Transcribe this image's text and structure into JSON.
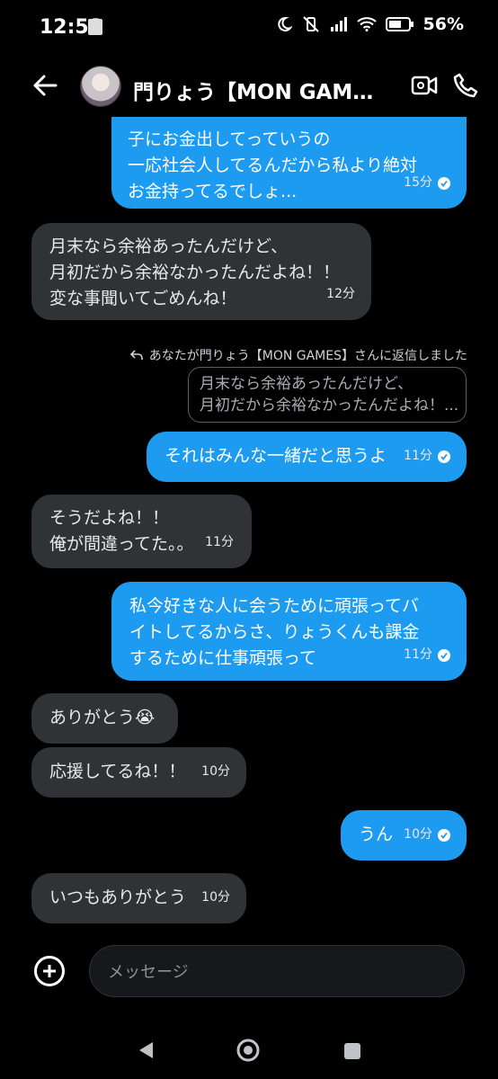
{
  "status_bar": {
    "time": "12:58",
    "battery": "56%"
  },
  "header": {
    "title": "門りょう【MON GAMES..."
  },
  "messages": [
    {
      "direction": "out",
      "lines": [
        "子にお金出してっていうの",
        "一応社会人してるんだから私より絶対",
        "お金持ってるでしょ..."
      ],
      "time": "15分",
      "read": true
    },
    {
      "direction": "in",
      "lines": [
        "月末なら余裕あったんだけど、",
        "月初だから余裕なかったんだよね！！",
        "変な事聞いてごめんね！"
      ],
      "time": "12分"
    },
    {
      "direction": "out",
      "lines": [
        "それはみんな一緒だと思うよ"
      ],
      "time": "11分",
      "read": true
    },
    {
      "direction": "in",
      "lines": [
        "そうだよね！！",
        "俺が間違ってた。。"
      ],
      "time": "11分"
    },
    {
      "direction": "out",
      "lines": [
        "私今好きな人に会うために頑張ってバ",
        "イトしてるからさ、りょうくんも課金",
        "するために仕事頑張って"
      ],
      "time": "11分",
      "read": true
    },
    {
      "direction": "in",
      "lines": [
        "ありがとう😭"
      ],
      "time": ""
    },
    {
      "direction": "in",
      "lines": [
        "応援してるね！！"
      ],
      "time": "10分"
    },
    {
      "direction": "out",
      "lines": [
        "うん"
      ],
      "time": "10分",
      "read": true
    },
    {
      "direction": "in",
      "lines": [
        "いつもありがとう"
      ],
      "time": "10分"
    }
  ],
  "reply": {
    "note": "あなたが門りょう【MON GAMES】さんに返信しました",
    "quote_lines": [
      "月末なら余裕あったんだけど、",
      "月初だから余裕なかったんだよね！..."
    ]
  },
  "composer": {
    "placeholder": "メッセージ"
  },
  "colors": {
    "outgoing_bubble": "#1d9bf0",
    "incoming_bubble": "#2f3336",
    "background": "#000000"
  },
  "icons": [
    "back-arrow-icon",
    "video-call-icon",
    "phone-icon",
    "add-icon",
    "nav-back-icon",
    "nav-home-icon",
    "nav-recents-icon"
  ]
}
